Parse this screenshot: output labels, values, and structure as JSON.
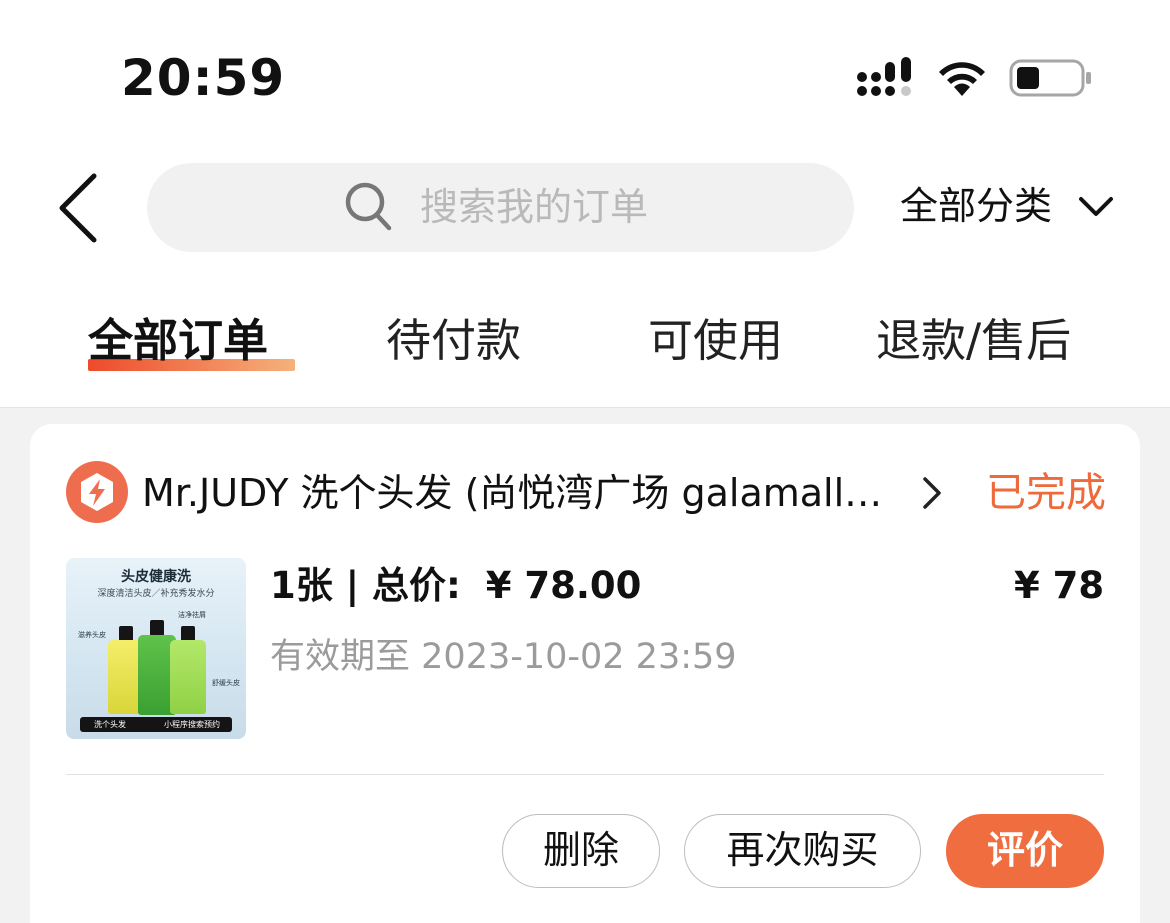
{
  "status_bar": {
    "time": "20:59"
  },
  "header": {
    "search_placeholder": "搜索我的订单",
    "category_label": "全部分类"
  },
  "tabs": [
    {
      "label": "全部订单",
      "active": true
    },
    {
      "label": "待付款",
      "active": false
    },
    {
      "label": "可使用",
      "active": false
    },
    {
      "label": "退款/售后",
      "active": false
    }
  ],
  "order": {
    "shop_name": "Mr.JUDY 洗个头发 (尚悦湾广场 galamall…",
    "status": "已完成",
    "quantity": "1张",
    "separator": "|",
    "total_label": "总价:",
    "total_price": "¥ 78.00",
    "price": "¥ 78",
    "validity_label": "有效期至",
    "validity_date": "2023-10-02 23:59",
    "thumbnail": {
      "title": "头皮健康洗",
      "subtitle": "深度清洁头皮／补充秀发水分",
      "captions": [
        "滋养头皮",
        "洁净祛屑",
        "舒缓头皮"
      ],
      "search_tag": "洗个头发",
      "mini_program_tag": "小程序搜索预约"
    },
    "actions": {
      "delete": "删除",
      "buy_again": "再次购买",
      "review": "评价"
    }
  },
  "colors": {
    "accent": "#ef6d3f",
    "status": "#ee6a3a",
    "tab_underline_start": "#ee4a2a",
    "tab_underline_end": "#f5b27c"
  },
  "icons": [
    "back-arrow-icon",
    "search-icon",
    "chevron-down-icon",
    "shop-logo-icon",
    "chevron-right-icon",
    "signal-icon",
    "wifi-icon",
    "battery-icon"
  ]
}
